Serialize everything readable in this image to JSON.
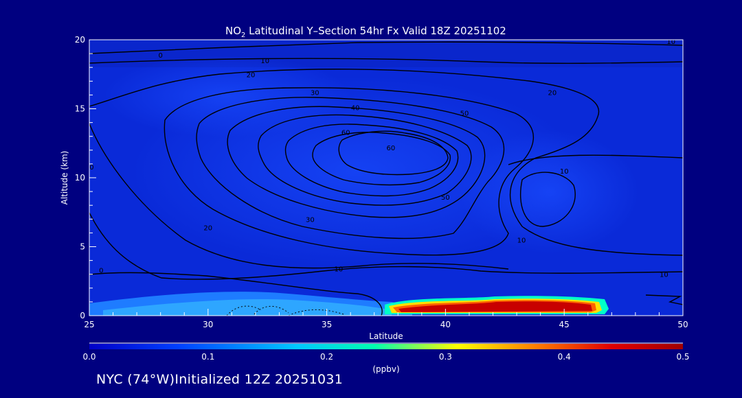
{
  "chart_data": {
    "type": "heatmap",
    "title_main": "NO",
    "title_sub": "2",
    "title_rest": " Latitudinal Y–Section 54hr  Fx Valid 18Z 20251102",
    "xlabel": "Latitude",
    "ylabel": "Altitude (km)",
    "xlim": [
      25,
      50
    ],
    "ylim": [
      0,
      20
    ],
    "x_ticks": [
      25,
      30,
      35,
      40,
      45,
      50
    ],
    "y_ticks": [
      0,
      5,
      10,
      15,
      20
    ],
    "colorbar": {
      "label": "(ppbv)",
      "min": 0.0,
      "max": 0.5,
      "ticks": [
        "0.0",
        "0.1",
        "0.2",
        "0.3",
        "0.4",
        "0.5"
      ],
      "colors": [
        "#0000c8",
        "#0040ff",
        "#00c8ff",
        "#00ffb0",
        "#ffff00",
        "#ff8000",
        "#e00000",
        "#a00000"
      ]
    },
    "contour_labels": [
      {
        "text": "0",
        "x": 28.0,
        "y": 18.9
      },
      {
        "text": "10",
        "x": 32.4,
        "y": 18.5
      },
      {
        "text": "10",
        "x": 49.5,
        "y": 19.9
      },
      {
        "text": "20",
        "x": 31.8,
        "y": 17.5
      },
      {
        "text": "30",
        "x": 34.5,
        "y": 16.2
      },
      {
        "text": "20",
        "x": 44.5,
        "y": 16.2
      },
      {
        "text": "40",
        "x": 36.2,
        "y": 15.1
      },
      {
        "text": "50",
        "x": 40.8,
        "y": 14.7
      },
      {
        "text": "60",
        "x": 35.8,
        "y": 13.3
      },
      {
        "text": "60",
        "x": 37.7,
        "y": 12.2
      },
      {
        "text": "10",
        "x": 45.0,
        "y": 10.5
      },
      {
        "text": "0",
        "x": 25.1,
        "y": 10.8
      },
      {
        "text": "50",
        "x": 40.0,
        "y": 8.6
      },
      {
        "text": "30",
        "x": 34.3,
        "y": 7.0
      },
      {
        "text": "20",
        "x": 30.0,
        "y": 6.4
      },
      {
        "text": "10",
        "x": 43.2,
        "y": 5.5
      },
      {
        "text": "0",
        "x": 25.5,
        "y": 3.3
      },
      {
        "text": "10",
        "x": 35.5,
        "y": 3.4
      },
      {
        "text": "10",
        "x": 49.2,
        "y": 3.0
      }
    ],
    "contour_levels": [
      0,
      10,
      20,
      30,
      40,
      50,
      60
    ],
    "grid": false
  },
  "footer": {
    "text": "NYC (74°W)Initialized 12Z 20251031"
  }
}
